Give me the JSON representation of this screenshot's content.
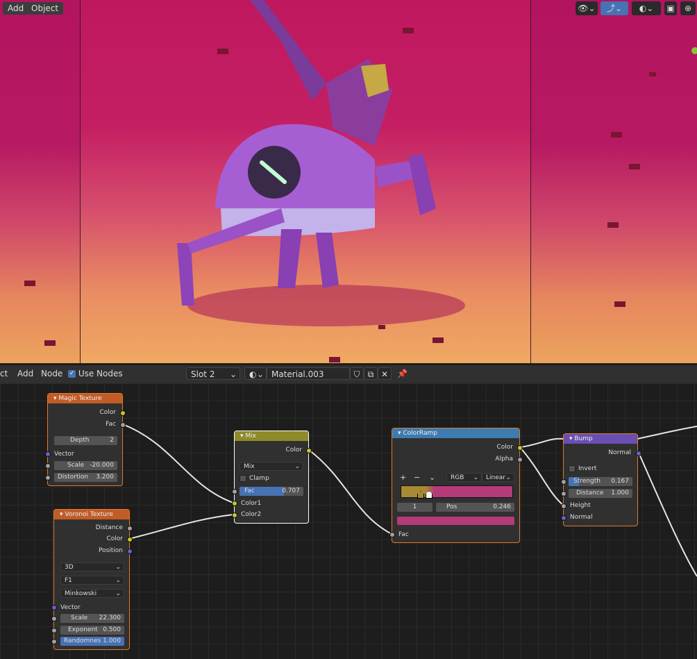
{
  "viewport": {
    "menu": [
      "Add",
      "Object"
    ],
    "colors": {
      "sky_top": "#b3135f",
      "sky_bottom": "#eca45e",
      "robot": "#9a4fc2"
    }
  },
  "header": {
    "menu": [
      "ct",
      "Add",
      "Node"
    ],
    "use_nodes_label": "Use Nodes",
    "use_nodes_checked": true,
    "slot": "Slot 2",
    "material": "Material.003"
  },
  "nodes": {
    "magic": {
      "title": "Magic Texture",
      "outputs": [
        "Color",
        "Fac"
      ],
      "depth_label": "Depth",
      "depth_value": "2",
      "vector": "Vector",
      "scale_label": "Scale",
      "scale_value": "-20.000",
      "distortion_label": "Distortion",
      "distortion_value": "3.200",
      "color": "#c15c27"
    },
    "voronoi": {
      "title": "Voronoi Texture",
      "outputs": [
        "Distance",
        "Color",
        "Position"
      ],
      "dims": "3D",
      "feature": "F1",
      "metric": "Minkowski",
      "vector": "Vector",
      "scale_label": "Scale",
      "scale_value": "22.300",
      "exponent_label": "Exponent",
      "exponent_value": "0.500",
      "random_label": "Randomnes",
      "random_value": "1.000",
      "color": "#c15c27"
    },
    "mix": {
      "title": "Mix",
      "output": "Color",
      "blend": "Mix",
      "clamp": "Clamp",
      "fac_label": "Fac",
      "fac_value": "0.707",
      "inputs": [
        "Color1",
        "Color2"
      ],
      "color": "#8f8a2a"
    },
    "colorramp": {
      "title": "ColorRamp",
      "outputs": [
        "Color",
        "Alpha"
      ],
      "controls": [
        "+",
        "−",
        "⌄"
      ],
      "mode": "RGB",
      "interp": "Linear",
      "index": "1",
      "pos_label": "Pos",
      "pos_value": "0.246",
      "input": "Fac",
      "colors": {
        "left": "#a68a34",
        "right": "#b53a7a",
        "swatch": "#b53a7a",
        "header": "#3d7bb0"
      }
    },
    "bump": {
      "title": "Bump",
      "output": "Normal",
      "invert": "Invert",
      "strength_label": "Strength",
      "strength_value": "0.167",
      "distance_label": "Distance",
      "distance_value": "1.000",
      "inputs": [
        "Height",
        "Normal"
      ],
      "color": "#6a4fb0"
    }
  }
}
